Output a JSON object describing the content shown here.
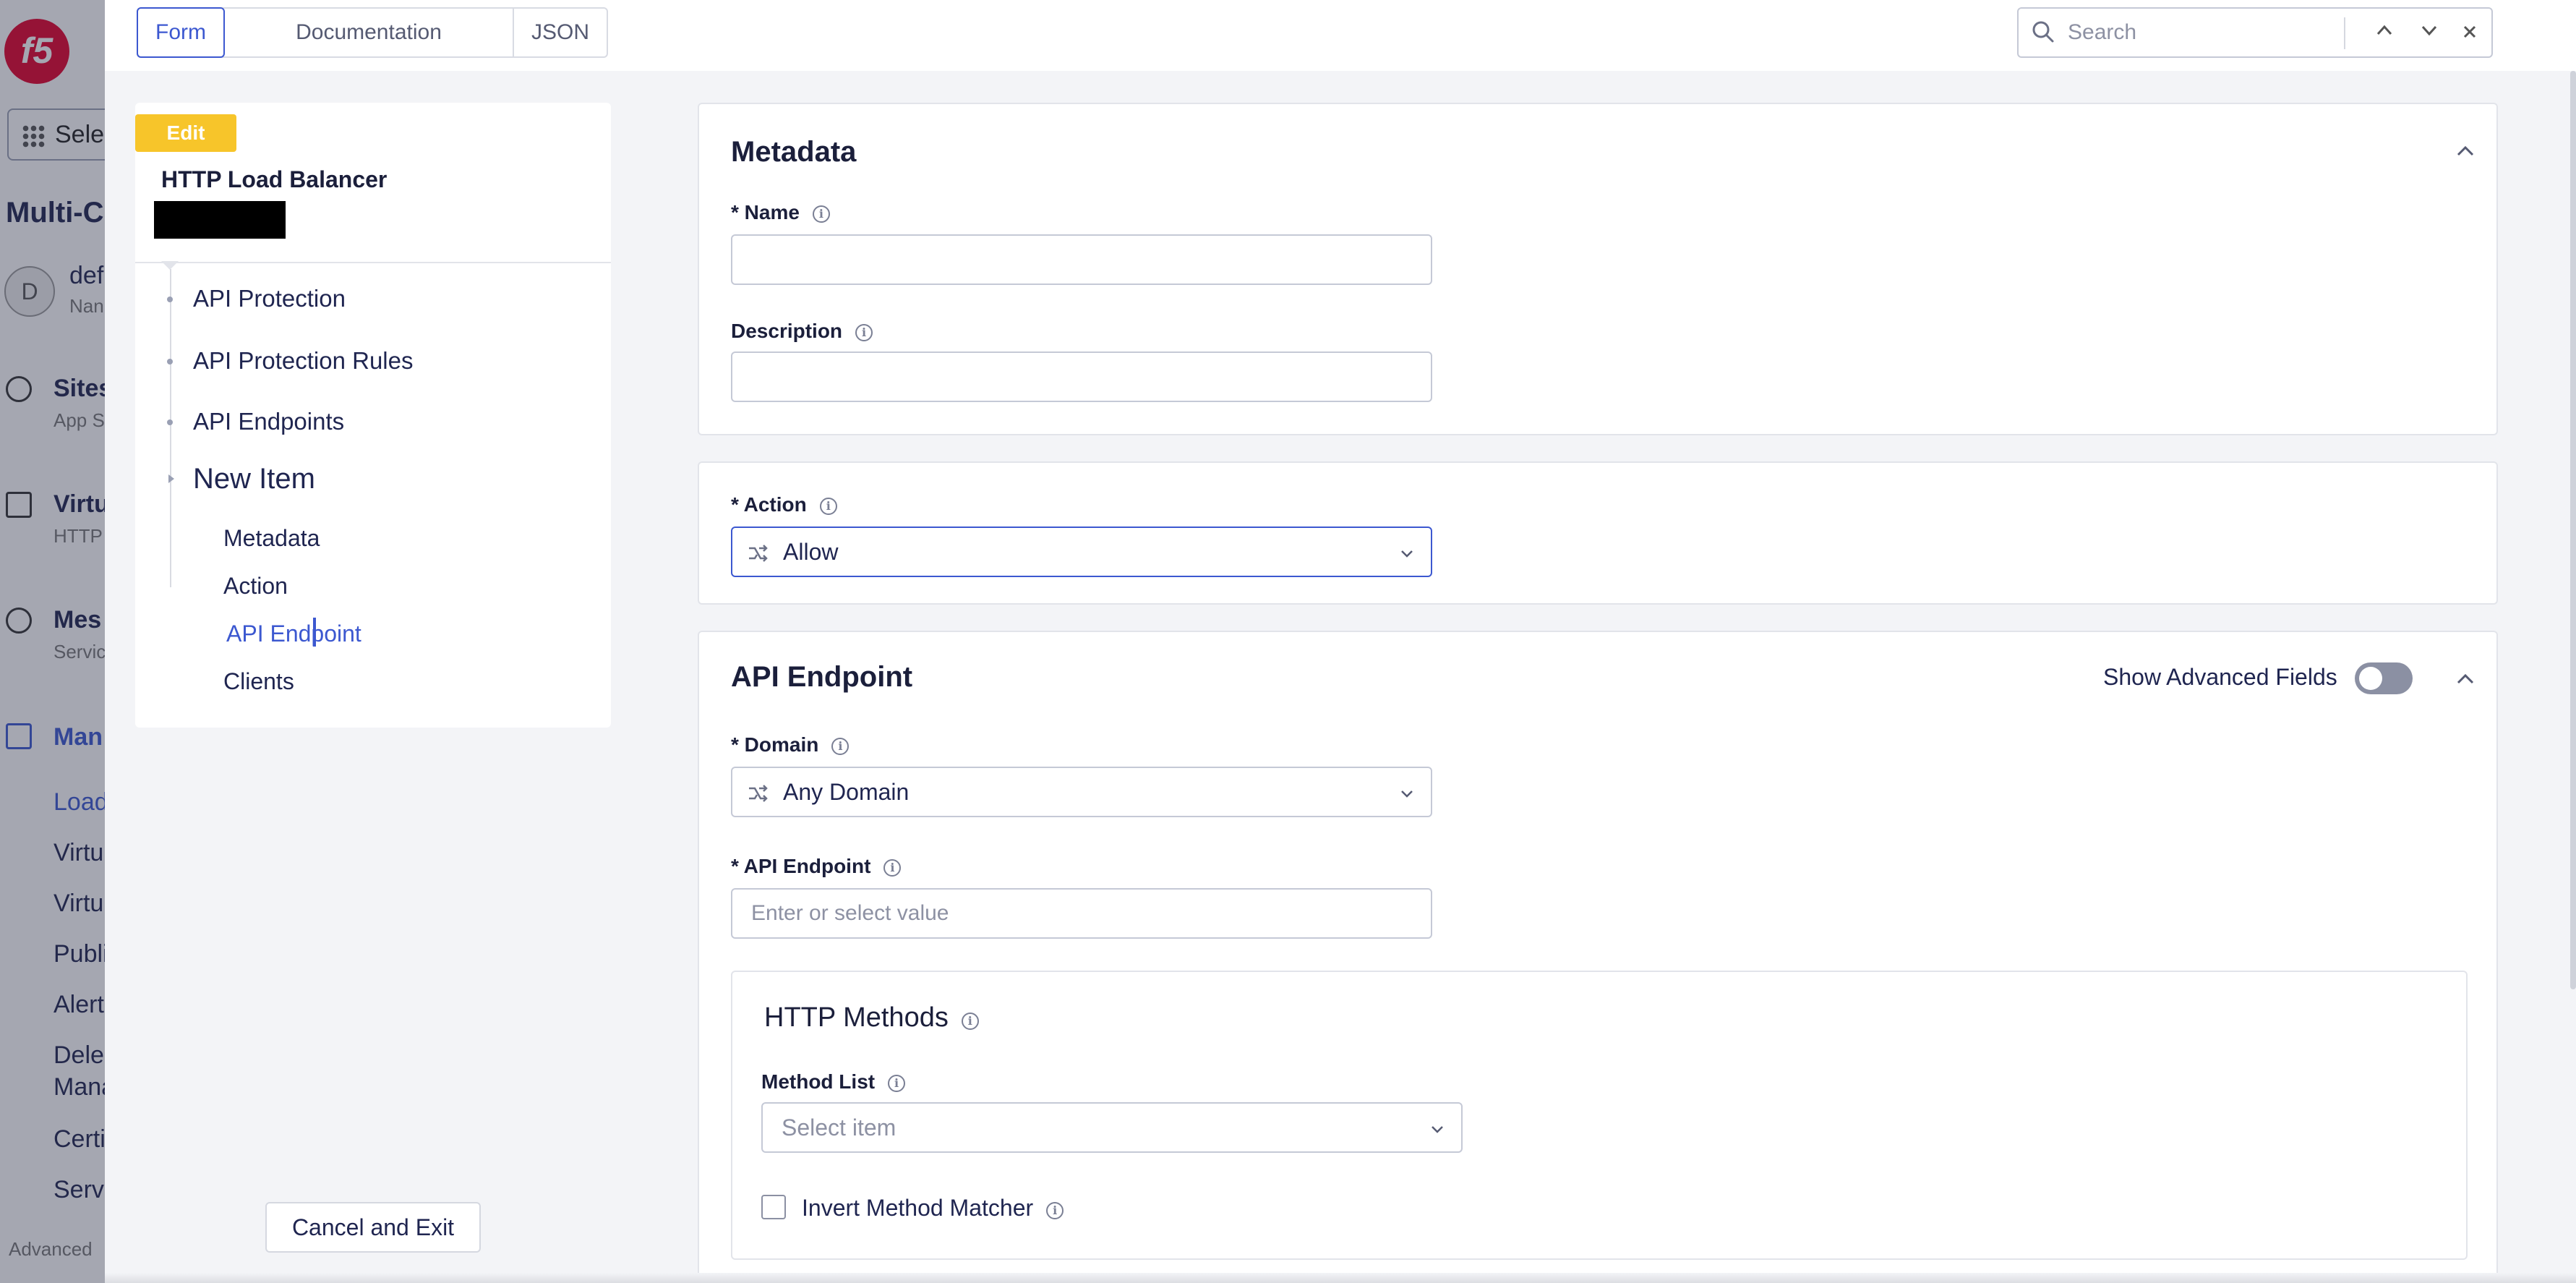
{
  "background_app": {
    "select_label": "Sele",
    "app_title": "Multi-C",
    "avatar_initial": "D",
    "namespace_name": "def",
    "namespace_sub": "Nan",
    "nav": [
      {
        "label": "Sites",
        "sub": "App S"
      },
      {
        "label": "Virtu",
        "sub": "HTTP"
      },
      {
        "label": "Mes",
        "sub": "Servic"
      },
      {
        "label": "Man",
        "sub": ""
      }
    ],
    "sub_nav": [
      "Load",
      "Virtu",
      "Virtu",
      "Publi",
      "Alert",
      "Deleg",
      "Mana",
      "Certi",
      "Servi"
    ],
    "footer": "Advanced"
  },
  "topbar": {
    "tabs": [
      "Form",
      "Documentation",
      "JSON"
    ],
    "search_placeholder": "Search",
    "prev_icon": "chevron-up-icon",
    "next_icon": "chevron-down-icon",
    "close_icon": "close-icon"
  },
  "sidebar": {
    "badge": "Edit",
    "title": "HTTP Load Balancer",
    "nav_items": [
      "API Protection",
      "API Protection Rules",
      "API Endpoints"
    ],
    "current_item": "New Item",
    "sub_items": [
      "Metadata",
      "Action",
      "API Endpoint",
      "Clients"
    ],
    "active_sub": "API Endpoint",
    "cancel_button": "Cancel and Exit"
  },
  "metadata": {
    "title": "Metadata",
    "name_label": "* Name",
    "name_value": "",
    "description_label": "Description",
    "description_value": ""
  },
  "action": {
    "label": "* Action",
    "value": "Allow"
  },
  "api_endpoint": {
    "title": "API Endpoint",
    "advanced_toggle_label": "Show Advanced Fields",
    "advanced_toggle_on": false,
    "domain_label": "* Domain",
    "domain_value": "Any Domain",
    "endpoint_label": "* API Endpoint",
    "endpoint_placeholder": "Enter or select value",
    "http_methods": {
      "title": "HTTP Methods",
      "method_list_label": "Method List",
      "method_list_placeholder": "Select item",
      "invert_label": "Invert Method Matcher",
      "invert_checked": false
    }
  },
  "colors": {
    "accent": "#3c58d0",
    "edit_badge": "#f7c52a",
    "brand": "#e4002b"
  }
}
